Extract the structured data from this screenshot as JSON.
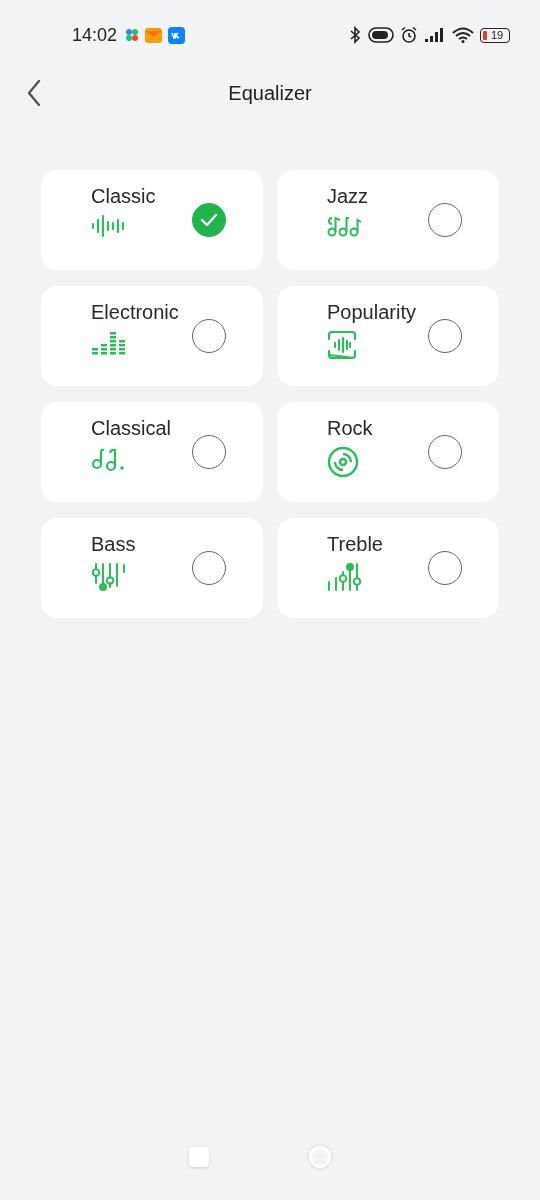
{
  "status_bar": {
    "time": "14:02",
    "battery": "19"
  },
  "header": {
    "title": "Equalizer"
  },
  "presets": [
    {
      "label": "Classic",
      "kind": "wave",
      "selected": true
    },
    {
      "label": "Jazz",
      "kind": "notes",
      "selected": false
    },
    {
      "label": "Electronic",
      "kind": "levels",
      "selected": false
    },
    {
      "label": "Popularity",
      "kind": "frame",
      "selected": false
    },
    {
      "label": "Classical",
      "kind": "melody",
      "selected": false
    },
    {
      "label": "Rock",
      "kind": "disc",
      "selected": false
    },
    {
      "label": "Bass",
      "kind": "sliders",
      "selected": false
    },
    {
      "label": "Treble",
      "kind": "rising",
      "selected": false
    }
  ]
}
